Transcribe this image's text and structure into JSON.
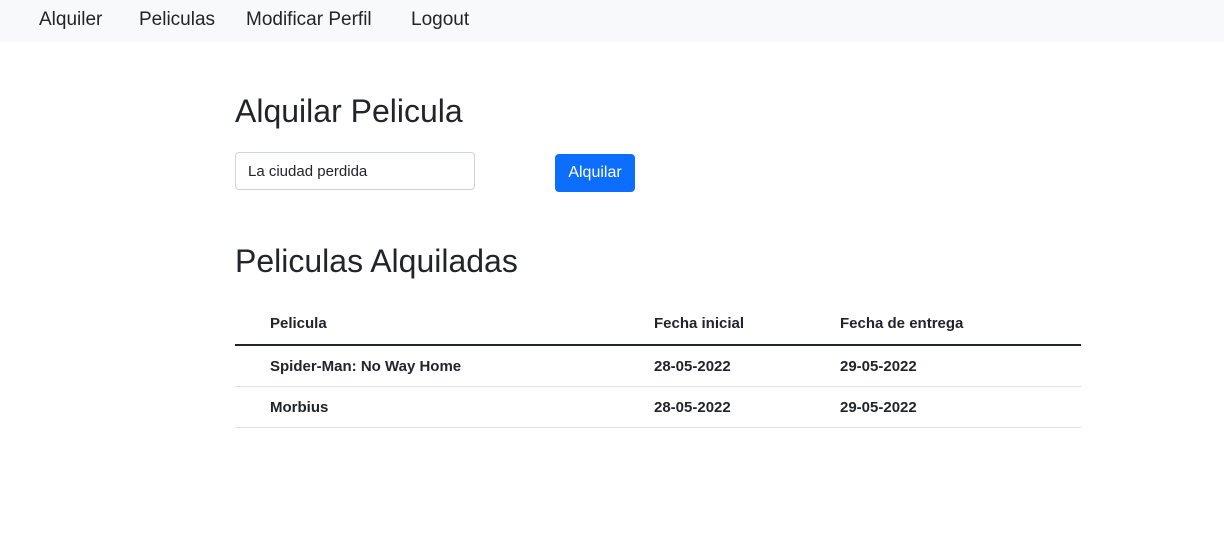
{
  "nav": {
    "items": [
      {
        "label": "Alquiler"
      },
      {
        "label": "Peliculas"
      },
      {
        "label": "Modificar Perfil"
      },
      {
        "label": "Logout"
      }
    ]
  },
  "rent_form": {
    "title": "Alquilar Pelicula",
    "input_value": "La ciudad perdida",
    "button_label": "Alquilar"
  },
  "rented": {
    "title": "Peliculas Alquiladas",
    "columns": [
      "Pelicula",
      "Fecha inicial",
      "Fecha de entrega"
    ],
    "rows": [
      [
        "Spider-Man: No Way Home",
        "28-05-2022",
        "29-05-2022"
      ],
      [
        "Morbius",
        "28-05-2022",
        "29-05-2022"
      ]
    ]
  }
}
